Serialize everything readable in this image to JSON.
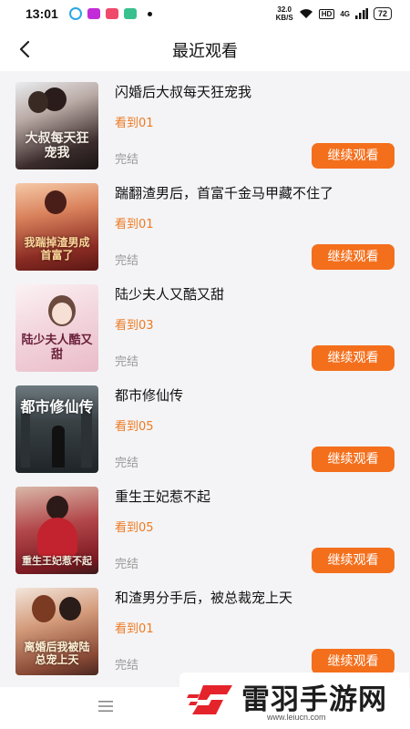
{
  "status_bar": {
    "time": "13:01",
    "net_speed_value": "32.0",
    "net_speed_unit": "KB/S",
    "hd_label": "HD",
    "signal_label": "4G",
    "battery": "72"
  },
  "header": {
    "title": "最近观看"
  },
  "books": [
    {
      "title": "闪婚后大叔每天狂宠我",
      "progress": "看到01",
      "status": "完结",
      "button": "继续观看",
      "cover_text": "大叔每天狂宠我"
    },
    {
      "title": "踹翻渣男后，首富千金马甲藏不住了",
      "progress": "看到01",
      "status": "完结",
      "button": "继续观看",
      "cover_text": "我踹掉渣男成首富了"
    },
    {
      "title": "陆少夫人又酷又甜",
      "progress": "看到03",
      "status": "完结",
      "button": "继续观看",
      "cover_text": "陆少夫人酷又甜"
    },
    {
      "title": "都市修仙传",
      "progress": "看到05",
      "status": "完结",
      "button": "继续观看",
      "cover_text": "都市修仙传"
    },
    {
      "title": "重生王妃惹不起",
      "progress": "看到05",
      "status": "完结",
      "button": "继续观看",
      "cover_text": "重生王妃惹不起"
    },
    {
      "title": "和渣男分手后，被总裁宠上天",
      "progress": "看到01",
      "status": "完结",
      "button": "继续观看",
      "cover_text": "离婚后我被陆总宠上天"
    }
  ],
  "watermark": {
    "text": "雷羽手游网",
    "url": "www.leiucn.com"
  },
  "colors": {
    "accent": "#f46f1c",
    "progress": "#ee7a22"
  }
}
